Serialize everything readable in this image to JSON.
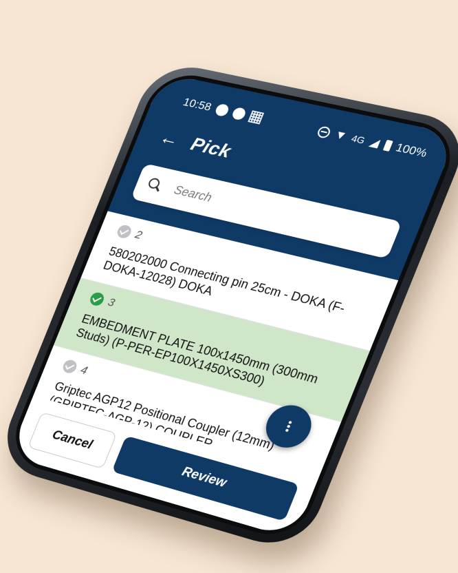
{
  "status_bar": {
    "time": "10:58",
    "network_label": "4G",
    "battery": "100%"
  },
  "header": {
    "title": "Pick",
    "back_icon": "arrow-left-icon"
  },
  "search": {
    "placeholder": "Search",
    "value": ""
  },
  "items": [
    {
      "number": "2",
      "description": "580202000 Connecting pin 25cm - DOKA (F-DOKA-12028) DOKA",
      "checked": false
    },
    {
      "number": "3",
      "description": "EMBEDMENT PLATE 100x1450mm (300mm Studs) (P-PER-EP100X1450XS300)",
      "checked": true
    },
    {
      "number": "4",
      "description": "Griptec AGP12 Positional Coupler (12mm) (GRIPTEC-AGP-12) COUPLER",
      "checked": false
    }
  ],
  "actions": {
    "cancel_label": "Cancel",
    "review_label": "Review"
  },
  "colors": {
    "primary": "#0f3a66",
    "selected_row": "#cfe6c9",
    "check_done": "#2e9b47",
    "check_pending": "#bfc1c5",
    "background": "#f6e6d3"
  }
}
